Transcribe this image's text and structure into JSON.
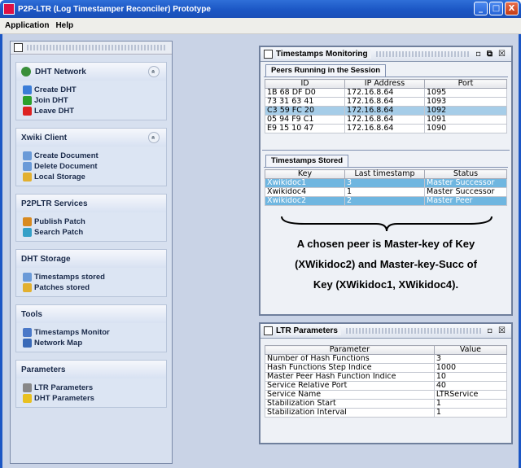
{
  "window": {
    "title": "P2P-LTR (Log Timestamper Reconciler) Prototype",
    "buttons": [
      "_",
      "□",
      "X"
    ]
  },
  "menu": [
    "Application",
    "Help"
  ],
  "sidebar": {
    "groups": [
      {
        "title": "DHT Network",
        "icon": "network-icon",
        "collapsible": true,
        "items": [
          {
            "label": "Create DHT",
            "icon": "globe-icon"
          },
          {
            "label": "Join DHT",
            "icon": "up-arrow-icon"
          },
          {
            "label": "Leave DHT",
            "icon": "flag-icon"
          }
        ]
      },
      {
        "title": "Xwiki Client",
        "icon": "",
        "collapsible": true,
        "items": [
          {
            "label": "Create Document",
            "icon": "document-icon"
          },
          {
            "label": "Delete Document",
            "icon": "document-icon"
          },
          {
            "label": "Local Storage",
            "icon": "folder-icon"
          }
        ]
      },
      {
        "title": "P2PLTR Services",
        "icon": "",
        "collapsible": false,
        "items": [
          {
            "label": "Publish Patch",
            "icon": "pencil-icon"
          },
          {
            "label": "Search Patch",
            "icon": "search-icon"
          }
        ]
      },
      {
        "title": "DHT Storage",
        "icon": "",
        "collapsible": false,
        "items": [
          {
            "label": "Timestamps stored",
            "icon": "document-icon"
          },
          {
            "label": "Patches stored",
            "icon": "folder-icon"
          }
        ]
      },
      {
        "title": "Tools",
        "icon": "",
        "collapsible": false,
        "items": [
          {
            "label": "Timestamps Monitor",
            "icon": "monitor-icon"
          },
          {
            "label": "Network Map",
            "icon": "network-map-icon"
          }
        ]
      },
      {
        "title": "Parameters",
        "icon": "",
        "collapsible": false,
        "items": [
          {
            "label": "LTR Parameters",
            "icon": "wrench-icon"
          },
          {
            "label": "DHT Parameters",
            "icon": "star-icon"
          }
        ]
      }
    ]
  },
  "monitoring": {
    "title": "Timestamps Monitoring",
    "peers_tab": "Peers Running in the Session",
    "peers_columns": [
      "ID",
      "IP Address",
      "Port"
    ],
    "peers_rows": [
      [
        "1B 68 DF D0",
        "172.16.8.64",
        "1095"
      ],
      [
        "73 31 63 41",
        "172.16.8.64",
        "1093"
      ],
      [
        "C3 59 FC 20",
        "172.16.8.64",
        "1092"
      ],
      [
        "05 94 F9 C1",
        "172.16.8.64",
        "1091"
      ],
      [
        "E9 15 10 47",
        "172.16.8.64",
        "1090"
      ]
    ],
    "stored_tab": "Timestamps Stored",
    "stored_columns": [
      "Key",
      "Last timestamp",
      "Status"
    ],
    "stored_rows": [
      [
        "Xwikidoc1",
        "3",
        "Master Successor"
      ],
      [
        "Xwikidoc4",
        "1",
        "Master Successor"
      ],
      [
        "Xwikidoc2",
        "2",
        "Master Peer"
      ]
    ],
    "annotation": [
      "A chosen peer is Master-key of Key",
      "(XWikidoc2) and Master-key-Succ of",
      "Key (XWikidoc1, XWikidoc4)."
    ]
  },
  "ltr": {
    "title": "LTR Parameters",
    "columns": [
      "Parameter",
      "Value"
    ],
    "rows": [
      [
        "Number of Hash Functions",
        "3"
      ],
      [
        "Hash Functions Step Indice",
        "1000"
      ],
      [
        "Master Peer Hash Function Indice",
        "10"
      ],
      [
        "Service Relative Port",
        "40"
      ],
      [
        "Service Name",
        "LTRService"
      ],
      [
        "Stabilization Start",
        "1"
      ],
      [
        "Stabilization Interval",
        "1"
      ]
    ]
  }
}
